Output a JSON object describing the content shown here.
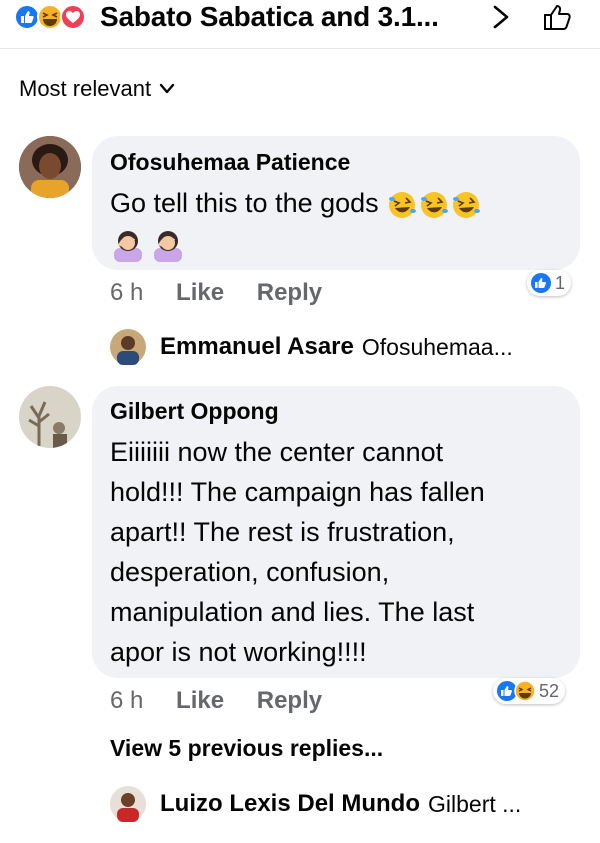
{
  "header": {
    "title": "Sabato Sabatica and 3.1..."
  },
  "sort": {
    "label": "Most relevant"
  },
  "comments": [
    {
      "author": "Ofosuhemaa Patience",
      "text_line1": "Go tell this to the gods",
      "time": "6 h",
      "like_label": "Like",
      "reply_label": "Reply",
      "reaction_count": "1",
      "reply_preview": {
        "name": "Emmanuel Asare",
        "snippet": "Ofosuhemaa..."
      }
    },
    {
      "author": "Gilbert Oppong",
      "text_lines": [
        "Eiiiiiii now the center cannot",
        "hold!!! The campaign has fallen",
        "apart!! The rest is frustration,",
        "desperation, confusion,",
        "manipulation and lies. The last",
        "apor is not working!!!!"
      ],
      "time": "6 h",
      "like_label": "Like",
      "reply_label": "Reply",
      "reaction_count": "52",
      "view_previous": "View 5 previous replies...",
      "reply_preview": {
        "name": "Luizo Lexis Del Mundo",
        "snippet": "Gilbert ..."
      }
    }
  ],
  "colors": {
    "bubble": "#f0f2f5",
    "meta_text": "#65676b",
    "like_blue": "#1877f2",
    "haha_yellow": "#f7b125",
    "love_red": "#f33e58"
  }
}
